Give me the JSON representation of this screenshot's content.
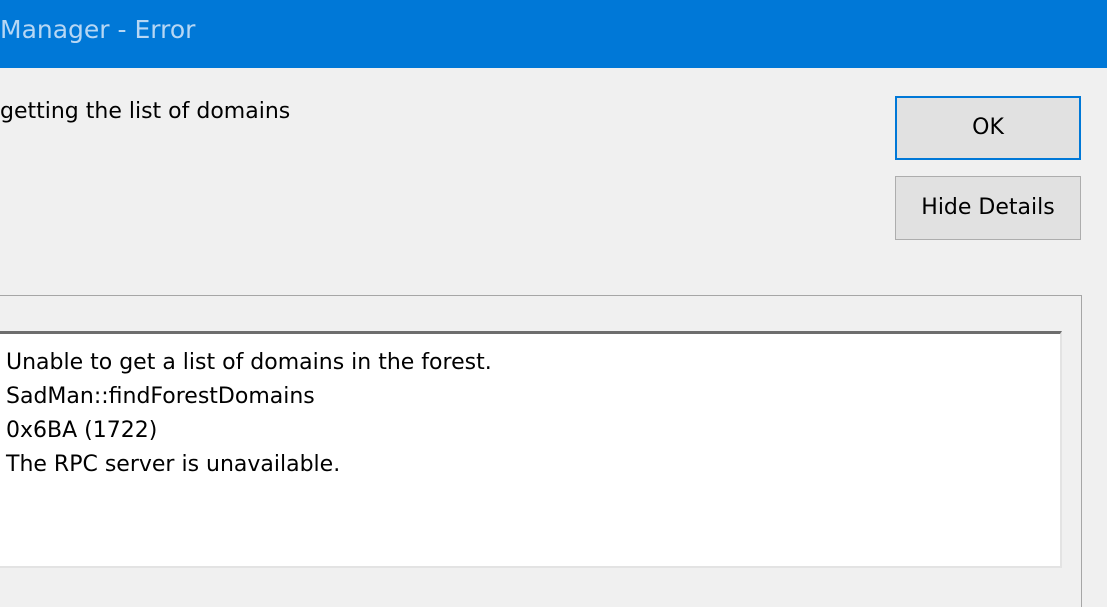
{
  "window": {
    "title": "Manager - Error"
  },
  "message": {
    "text": "getting the list of domains"
  },
  "buttons": {
    "ok_label": "OK",
    "details_label": "Hide Details"
  },
  "details": {
    "lines": [
      "Unable to get a list of domains in the forest.",
      "SadMan::findForestDomains",
      "0x6BA (1722)",
      "The RPC server is unavailable."
    ]
  },
  "colors": {
    "titlebar": "#0078d7",
    "dialog_background": "#f0f0f0",
    "details_background": "#ffffff"
  }
}
